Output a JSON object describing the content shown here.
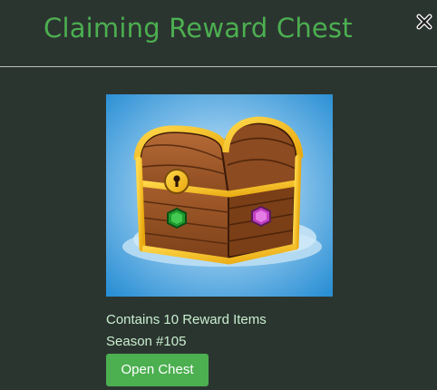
{
  "modal": {
    "title": "Claiming Reward Chest",
    "close_icon": "close-icon",
    "image": {
      "icon": "treasure-chest-image",
      "background_color": "#2a8fd4",
      "cloud_color": "#bfe0f5"
    },
    "info": {
      "items_text": "Contains 10 Reward Items",
      "season_text": "Season #105"
    },
    "open_button_label": "Open Chest"
  },
  "colors": {
    "background": "#2b3530",
    "accent": "#4caf50",
    "info_text": "#c9efcf",
    "divider": "#b9c0bb"
  }
}
